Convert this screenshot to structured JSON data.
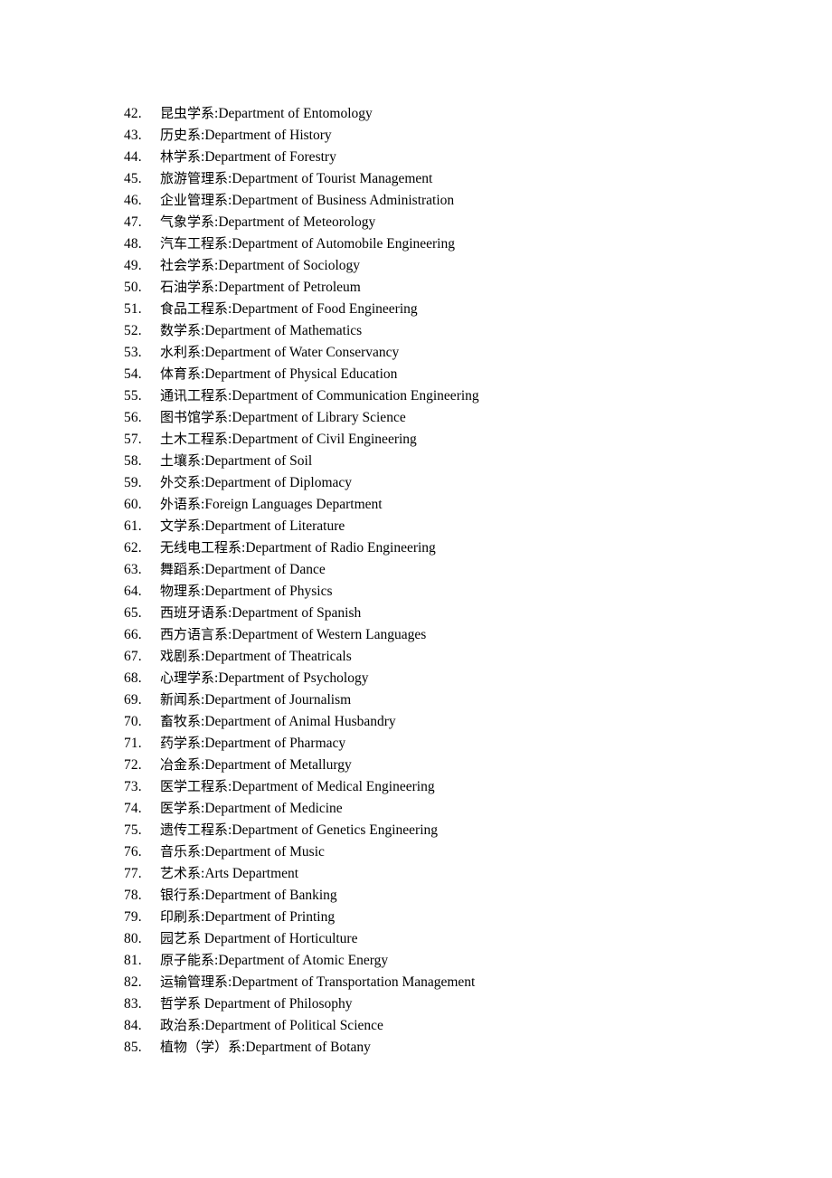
{
  "document": {
    "page_background": "#ffffff",
    "text_color": "#000000",
    "separator_colon": ":",
    "separator_space": "  "
  },
  "list": {
    "items": [
      {
        "number": "42.",
        "chinese": "昆虫学系",
        "separator": ":",
        "english": "Department of Entomology"
      },
      {
        "number": "43.",
        "chinese": "历史系",
        "separator": ":",
        "english": "Department of History"
      },
      {
        "number": "44.",
        "chinese": "林学系",
        "separator": ":",
        "english": "Department of Forestry"
      },
      {
        "number": "45.",
        "chinese": "旅游管理系",
        "separator": ":",
        "english": "Department of Tourist Management"
      },
      {
        "number": "46.",
        "chinese": "企业管理系",
        "separator": ":",
        "english": "Department of Business Administration"
      },
      {
        "number": "47.",
        "chinese": "气象学系",
        "separator": ":",
        "english": "Department of Meteorology"
      },
      {
        "number": "48.",
        "chinese": "汽车工程系",
        "separator": ":",
        "english": "Department of Automobile Engineering"
      },
      {
        "number": "49.",
        "chinese": "社会学系",
        "separator": ":",
        "english": "Department of Sociology"
      },
      {
        "number": "50.",
        "chinese": "石油学系",
        "separator": ":",
        "english": "Department of Petroleum"
      },
      {
        "number": "51.",
        "chinese": "食品工程系",
        "separator": ":",
        "english": "Department of Food Engineering"
      },
      {
        "number": "52.",
        "chinese": "数学系",
        "separator": ":",
        "english": "Department of Mathematics"
      },
      {
        "number": "53.",
        "chinese": "水利系",
        "separator": ":",
        "english": "Department of Water Conservancy"
      },
      {
        "number": "54.",
        "chinese": "体育系",
        "separator": ":",
        "english": "Department of Physical Education"
      },
      {
        "number": "55.",
        "chinese": "通讯工程系",
        "separator": ":",
        "english": "Department of Communication Engineering"
      },
      {
        "number": "56.",
        "chinese": "图书馆学系",
        "separator": ":",
        "english": "Department of Library Science"
      },
      {
        "number": "57.",
        "chinese": "土木工程系",
        "separator": ":",
        "english": "Department of Civil Engineering"
      },
      {
        "number": "58.",
        "chinese": "土壤系",
        "separator": ":",
        "english": "Department of Soil"
      },
      {
        "number": "59.",
        "chinese": "外交系",
        "separator": ":",
        "english": "Department of Diplomacy"
      },
      {
        "number": "60.",
        "chinese": "外语系",
        "separator": ":",
        "english": "Foreign Languages Department"
      },
      {
        "number": "61.",
        "chinese": "文学系",
        "separator": ":",
        "english": "Department of Literature"
      },
      {
        "number": "62.",
        "chinese": "无线电工程系",
        "separator": ":",
        "english": "Department of Radio Engineering"
      },
      {
        "number": "63.",
        "chinese": "舞蹈系",
        "separator": ":",
        "english": "Department of Dance"
      },
      {
        "number": "64.",
        "chinese": "物理系",
        "separator": ":",
        "english": "Department of Physics"
      },
      {
        "number": "65.",
        "chinese": "西班牙语系",
        "separator": ":",
        "english": "Department of Spanish"
      },
      {
        "number": "66.",
        "chinese": "西方语言系",
        "separator": ":",
        "english": "Department of Western Languages"
      },
      {
        "number": "67.",
        "chinese": "戏剧系",
        "separator": ":",
        "english": "Department of Theatricals"
      },
      {
        "number": "68.",
        "chinese": "心理学系",
        "separator": ":",
        "english": "Department of Psychology"
      },
      {
        "number": "69.",
        "chinese": "新闻系",
        "separator": ":",
        "english": "Department of Journalism"
      },
      {
        "number": "70.",
        "chinese": "畜牧系",
        "separator": ":",
        "english": "Department of Animal Husbandry"
      },
      {
        "number": "71.",
        "chinese": "药学系",
        "separator": ":",
        "english": "Department of Pharmacy"
      },
      {
        "number": "72.",
        "chinese": "冶金系",
        "separator": ":",
        "english": "Department of Metallurgy"
      },
      {
        "number": "73.",
        "chinese": "医学工程系",
        "separator": ":",
        "english": "Department of Medical Engineering"
      },
      {
        "number": "74.",
        "chinese": "医学系",
        "separator": ":",
        "english": "Department of Medicine"
      },
      {
        "number": "75.",
        "chinese": "遗传工程系",
        "separator": ":",
        "english": "Department of Genetics Engineering"
      },
      {
        "number": "76.",
        "chinese": "音乐系",
        "separator": ":",
        "english": "Department of Music"
      },
      {
        "number": "77.",
        "chinese": "艺术系",
        "separator": ":",
        "english": "Arts Department"
      },
      {
        "number": "78.",
        "chinese": "银行系",
        "separator": ":",
        "english": "Department of Banking"
      },
      {
        "number": "79.",
        "chinese": "印刷系",
        "separator": ":",
        "english": "Department of Printing"
      },
      {
        "number": "80.",
        "chinese": "园艺系",
        "separator": "  ",
        "english": "Department of Horticulture"
      },
      {
        "number": "81.",
        "chinese": "原子能系",
        "separator": ":",
        "english": "Department of Atomic Energy"
      },
      {
        "number": "82.",
        "chinese": "运输管理系",
        "separator": ":",
        "english": "Department of Transportation Management"
      },
      {
        "number": "83.",
        "chinese": "哲学系",
        "separator": "  ",
        "english": "Department of Philosophy"
      },
      {
        "number": "84.",
        "chinese": "政治系",
        "separator": ":",
        "english": "Department of Political Science"
      },
      {
        "number": "85.",
        "chinese": "植物（学）系",
        "separator": ":",
        "english": "Department of Botany"
      }
    ]
  }
}
